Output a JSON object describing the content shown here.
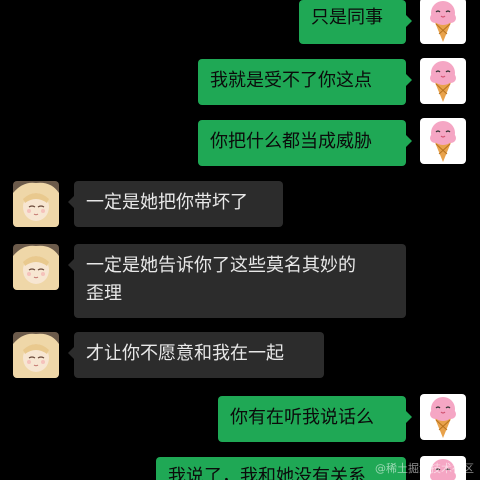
{
  "colors": {
    "background": "#000000",
    "my_bubble": "#1fa855",
    "other_bubble": "#2c2c2c",
    "my_text": "#0b0b0b",
    "other_text": "#e8e8e8"
  },
  "messages": [
    {
      "sender": "me",
      "avatar_icon": "ice-cream-avatar-icon",
      "text": "只是同事"
    },
    {
      "sender": "me",
      "avatar_icon": "ice-cream-avatar-icon",
      "text": "我就是受不了你这点"
    },
    {
      "sender": "me",
      "avatar_icon": "ice-cream-avatar-icon",
      "text": "你把什么都当成威胁"
    },
    {
      "sender": "other",
      "avatar_icon": "anime-girl-avatar-icon",
      "text": "一定是她把你带坏了"
    },
    {
      "sender": "other",
      "avatar_icon": "anime-girl-avatar-icon",
      "text_line1": "一定是她告诉你了这些莫名其妙的",
      "text_line2": "歪理"
    },
    {
      "sender": "other",
      "avatar_icon": "anime-girl-avatar-icon",
      "text": "才让你不愿意和我在一起"
    },
    {
      "sender": "me",
      "avatar_icon": "ice-cream-avatar-icon",
      "text": "你有在听我说话么"
    },
    {
      "sender": "me",
      "avatar_icon": "ice-cream-avatar-icon",
      "text": "我说了，我和她没有关系"
    }
  ],
  "watermark": "@稀土掘金技术社区"
}
